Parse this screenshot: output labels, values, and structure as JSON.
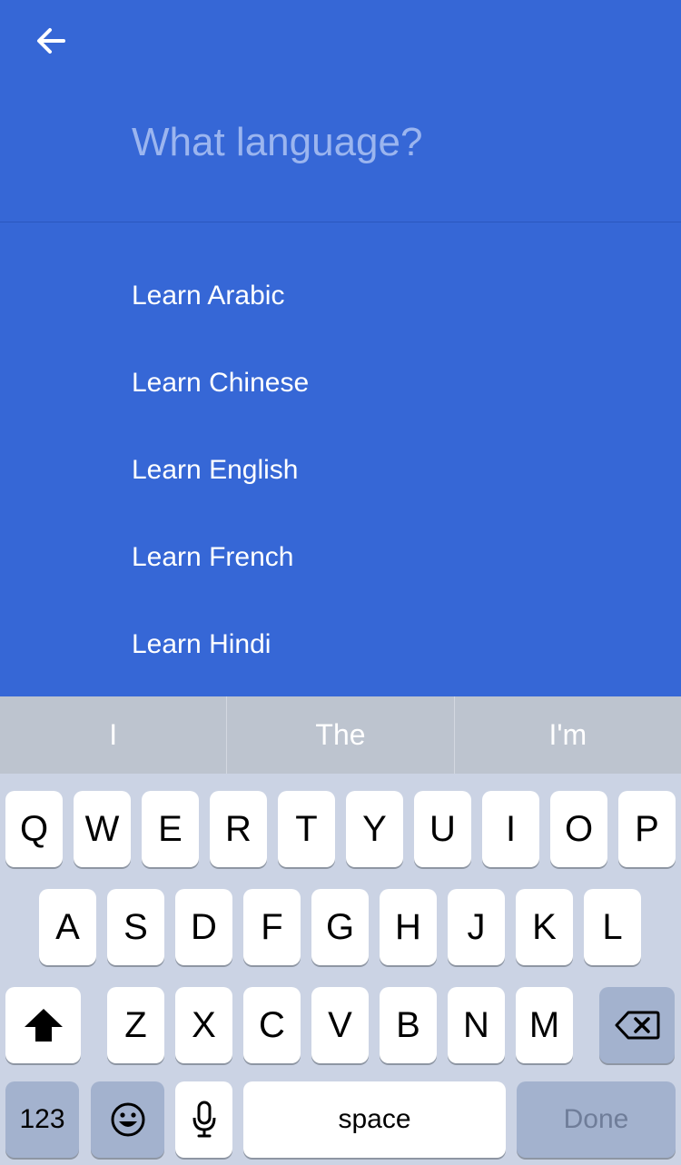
{
  "header": {
    "back_icon": "arrow-left-icon",
    "search_placeholder": "What language?",
    "search_value": ""
  },
  "results": [
    "Learn Arabic",
    "Learn Chinese",
    "Learn English",
    "Learn French",
    "Learn Hindi"
  ],
  "keyboard": {
    "suggestions": [
      "I",
      "The",
      "I'm"
    ],
    "row1": [
      "Q",
      "W",
      "E",
      "R",
      "T",
      "Y",
      "U",
      "I",
      "O",
      "P"
    ],
    "row2": [
      "A",
      "S",
      "D",
      "F",
      "G",
      "H",
      "J",
      "K",
      "L"
    ],
    "row3": [
      "Z",
      "X",
      "C",
      "V",
      "B",
      "N",
      "M"
    ],
    "numbers_label": "123",
    "space_label": "space",
    "done_label": "Done",
    "shift_icon": "shift-icon",
    "backspace_icon": "backspace-icon",
    "emoji_icon": "emoji-icon",
    "mic_icon": "microphone-icon"
  },
  "colors": {
    "background": "#3667d6",
    "placeholder": "#9bb5ef",
    "keyboard_bg": "#cbd3e4",
    "suggestion_bar": "#bdc4cf",
    "dark_key": "#a3b2ce"
  }
}
